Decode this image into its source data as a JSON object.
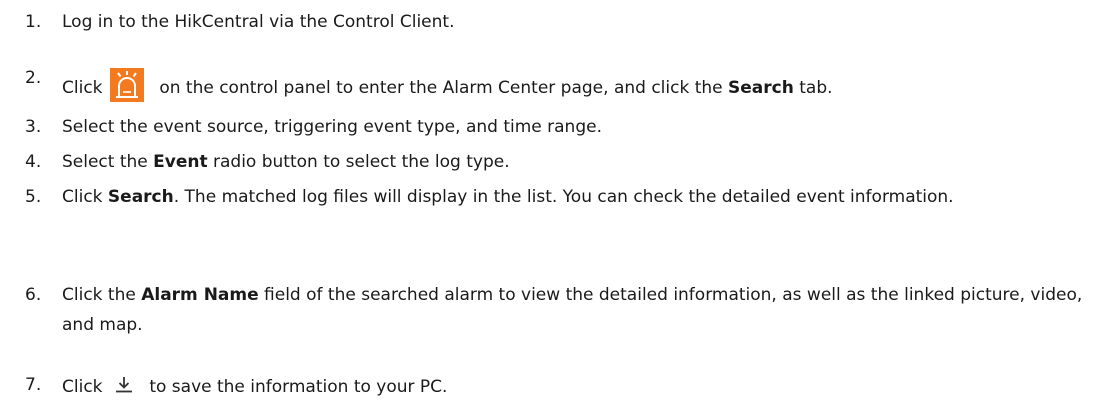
{
  "steps": [
    {
      "num": "1.",
      "parts": [
        "Log in to the HikCentral via the Control Client."
      ]
    },
    {
      "num": "2.",
      "pre": "Click",
      "post_a": "on the control panel to enter the Alarm Center page, and click the ",
      "bold": "Search",
      "post_b": " tab."
    },
    {
      "num": "3.",
      "text": "Select the event source, triggering event type, and time range."
    },
    {
      "num": "4.",
      "pre": "Select the ",
      "bold": "Event",
      "post": " radio button to select the log type."
    },
    {
      "num": "5.",
      "pre": "Click ",
      "bold": "Search",
      "post": ". The matched log files will display in the list. You can check the detailed event information."
    },
    {
      "num": "6.",
      "pre": "Click the ",
      "bold": "Alarm Name",
      "post": " field of the searched alarm to view the detailed information, as well as the linked picture, video, and map."
    },
    {
      "num": "7.",
      "pre": "Click",
      "post": "to save the information to your PC."
    }
  ],
  "icons": {
    "alarm_center": "alarm-center-icon",
    "download": "download-icon",
    "alarm_color": "#f47a20"
  }
}
